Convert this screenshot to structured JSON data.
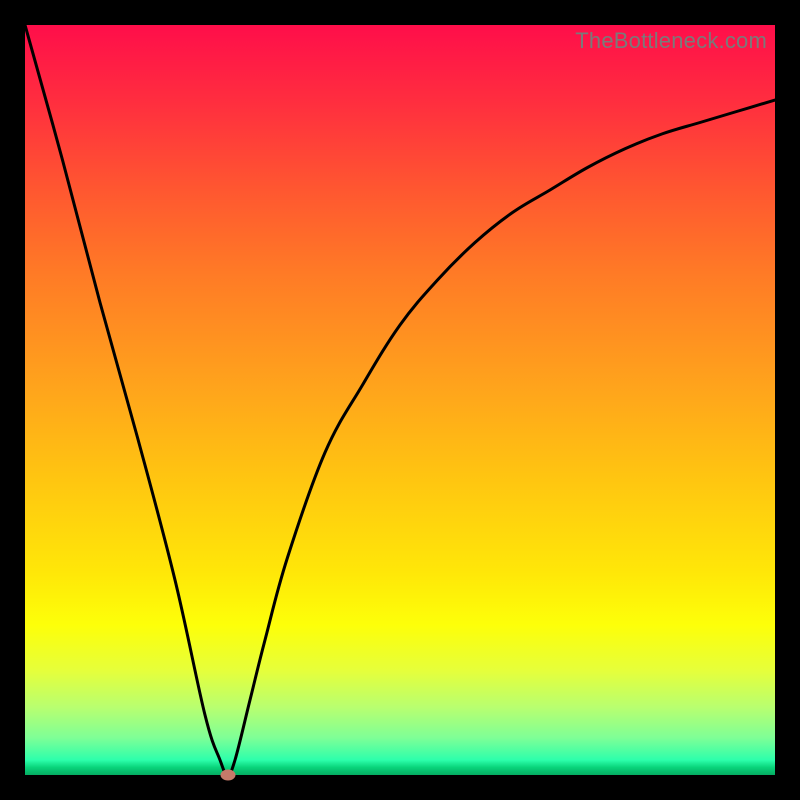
{
  "watermark": "TheBottleneck.com",
  "chart_data": {
    "type": "line",
    "title": "",
    "xlabel": "",
    "ylabel": "",
    "xlim": [
      0,
      100
    ],
    "ylim": [
      0,
      100
    ],
    "grid": false,
    "legend": false,
    "series": [
      {
        "name": "bottleneck-curve",
        "x": [
          0,
          5,
          10,
          15,
          20,
          24,
          26,
          27,
          28,
          30,
          32,
          35,
          40,
          45,
          50,
          55,
          60,
          65,
          70,
          75,
          80,
          85,
          90,
          95,
          100
        ],
        "y": [
          100,
          82,
          63,
          45,
          26,
          8,
          2,
          0,
          2,
          10,
          18,
          29,
          43,
          52,
          60,
          66,
          71,
          75,
          78,
          81,
          83.5,
          85.5,
          87,
          88.5,
          90
        ]
      }
    ],
    "annotations": [
      {
        "type": "marker",
        "x": 27,
        "y": 0,
        "label": "optimal-point"
      }
    ],
    "background_gradient": {
      "direction": "vertical",
      "stops": [
        {
          "pos": 0.0,
          "color": "#ff0e4a"
        },
        {
          "pos": 0.5,
          "color": "#ffb516"
        },
        {
          "pos": 0.83,
          "color": "#fdff09"
        },
        {
          "pos": 0.99,
          "color": "#08d37a"
        },
        {
          "pos": 1.0,
          "color": "#05ac62"
        }
      ]
    }
  }
}
